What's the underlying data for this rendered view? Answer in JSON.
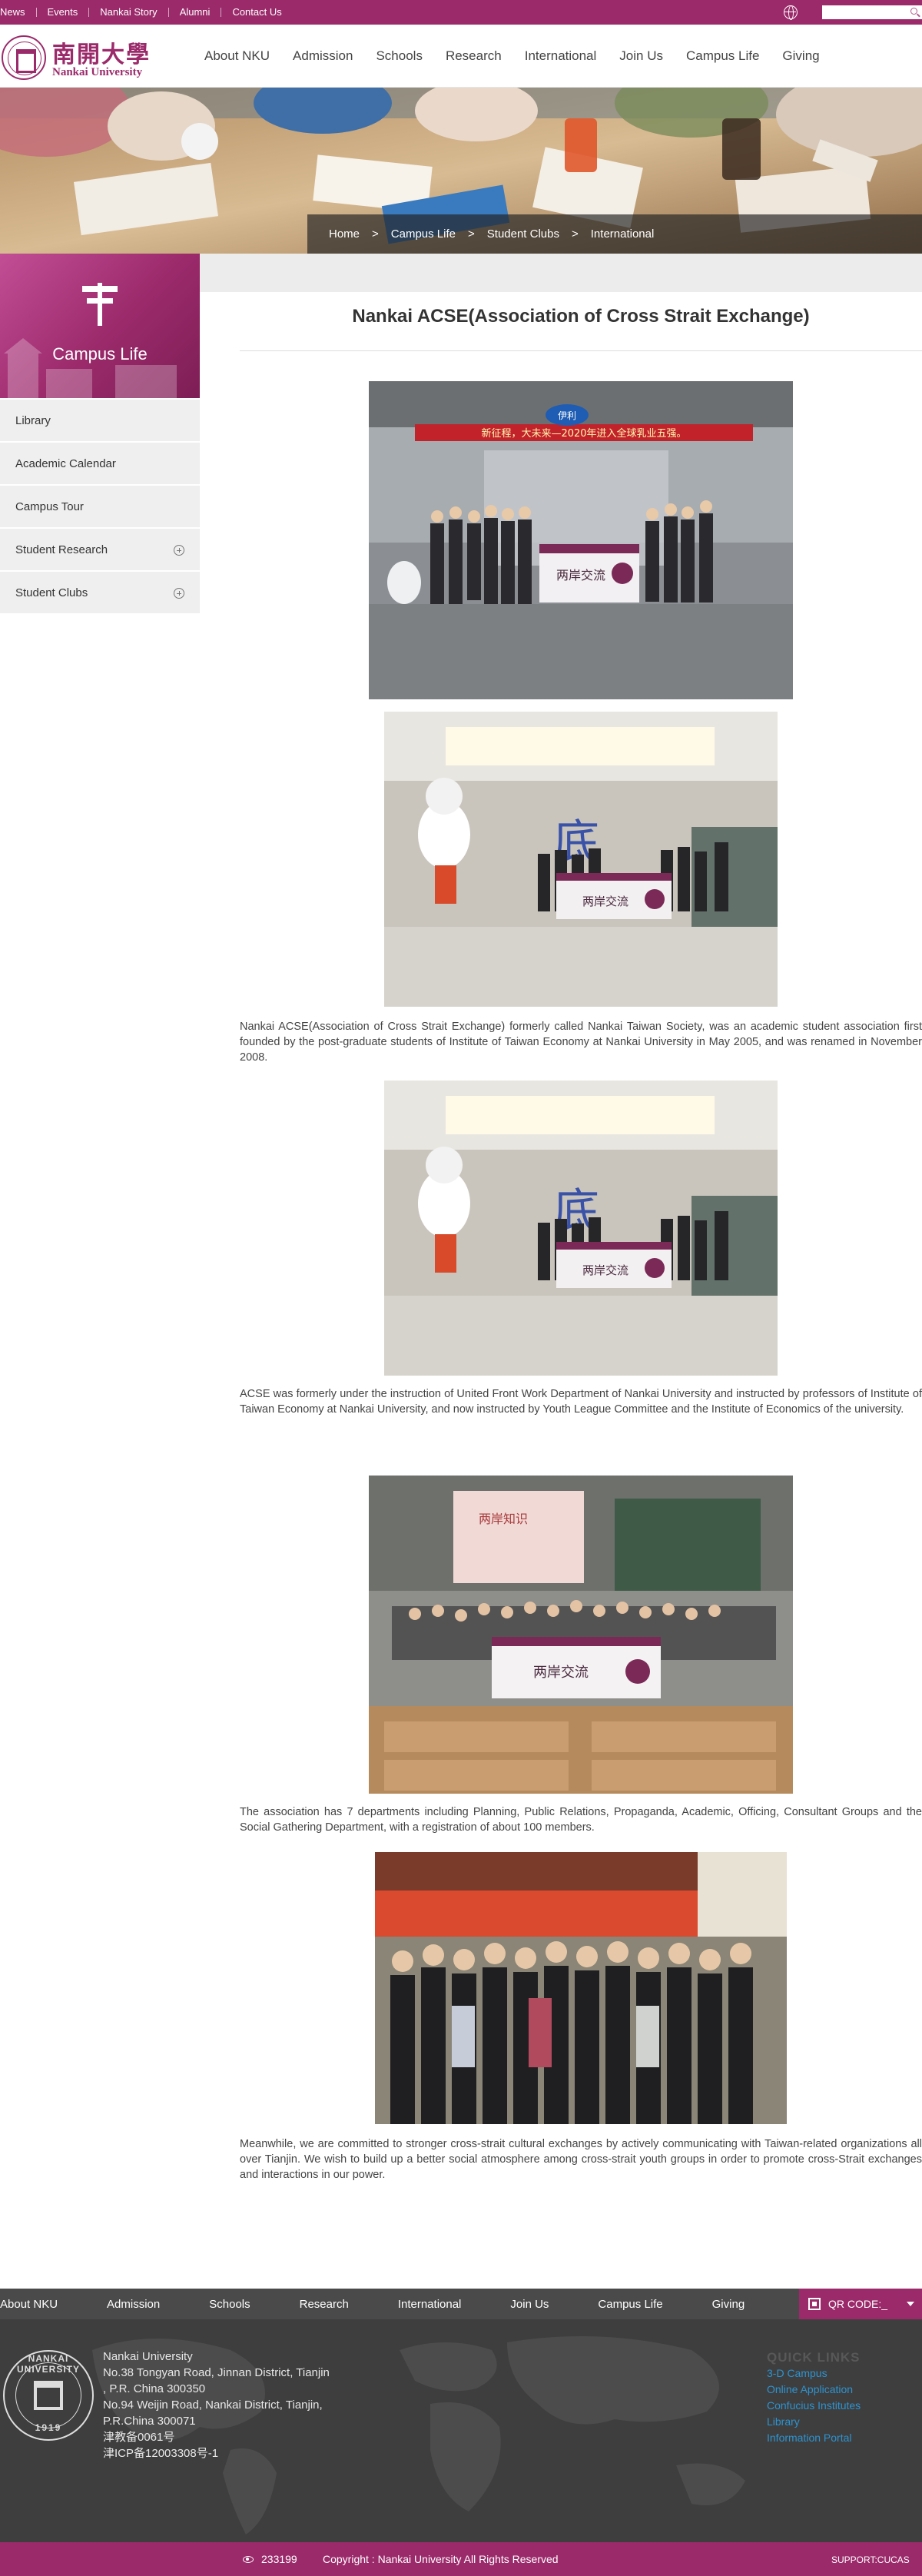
{
  "topbar": {
    "links": [
      "News",
      "Events",
      "Nankai Story",
      "Alumni",
      "Contact Us"
    ],
    "search_placeholder": ""
  },
  "logo": {
    "chinese": "南開大學",
    "english": "Nankai University"
  },
  "mainnav": [
    "About NKU",
    "Admission",
    "Schools",
    "Research",
    "International",
    "Join Us",
    "Campus Life",
    "Giving"
  ],
  "breadcrumb": [
    "Home",
    "Campus Life",
    "Student Clubs",
    "International"
  ],
  "breadcrumb_sep": ">",
  "sidebar": {
    "title": "Campus Life",
    "items": [
      {
        "label": "Library",
        "expandable": false
      },
      {
        "label": "Academic Calendar",
        "expandable": false
      },
      {
        "label": "Campus Tour",
        "expandable": false
      },
      {
        "label": "Student Research",
        "expandable": true
      },
      {
        "label": "Student Clubs",
        "expandable": true
      }
    ]
  },
  "article": {
    "title": "Nankai ACSE(Association of Cross Strait Exchange)",
    "paragraphs": [
      "Nankai ACSE(Association of Cross Strait Exchange) formerly called Nankai Taiwan Society, was an academic student association first founded by the post-graduate students of Institute of Taiwan Economy at Nankai University in May 2005, and was renamed in November 2008.",
      "ACSE was formerly under the instruction of United Front Work Department of Nankai University and instructed by professors of Institute of Taiwan Economy at Nankai University, and now instructed by Youth League Committee and the Institute of Economics of the university.",
      "The association has 7 departments including Planning, Public Relations, Propaganda, Academic, Officing, Consultant Groups and the Social Gathering Department, with a registration of about 100 members.",
      "Meanwhile, we are committed to stronger cross-strait cultural exchanges by actively communicating with Taiwan-related organizations all over Tianjin. We wish to build up a better social atmosphere among cross-strait youth groups in order to promote cross-Strait exchanges and interactions in our power."
    ],
    "photo1_banner": "新征程，大未来—2020年进入全球乳业五强。",
    "photo1_logo": "伊利"
  },
  "footer": {
    "nav": [
      "About NKU",
      "Admission",
      "Schools",
      "Research",
      "International",
      "Join Us",
      "Campus Life",
      "Giving"
    ],
    "qr_label": "QR CODE:_",
    "seal_name": "NANKAI UNIVERSITY",
    "seal_year": "1919",
    "address_lines": [
      "Nankai University",
      "No.38 Tongyan Road, Jinnan District, Tianjin",
      ", P.R. China 300350",
      "No.94 Weijin Road,  Nankai District, Tianjin,",
      "P.R.China  300071",
      "津教备0061号",
      "津ICP备12003308号-1"
    ],
    "quick_title": "QUICK LINKS",
    "quick_links": [
      "3-D Campus",
      "Online Application",
      "Confucius Institutes",
      "Library",
      "Information Portal"
    ],
    "visits": "233199",
    "copyright": "Copyright : Nankai University All Rights Reserved",
    "support": "SUPPORT:CUCAS"
  },
  "colors": {
    "brand": "#9b2a6b",
    "footer_dark": "#3e3e3e",
    "link_blue": "#2d93d0"
  }
}
